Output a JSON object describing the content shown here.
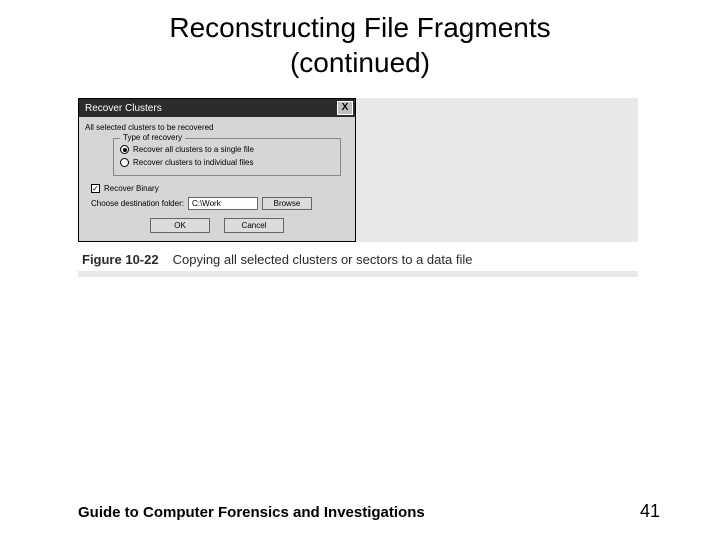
{
  "slide": {
    "title_line1": "Reconstructing File Fragments",
    "title_line2": "(continued)"
  },
  "dialog": {
    "title": "Recover Clusters",
    "close_glyph": "X",
    "note": "All selected clusters to be recovered",
    "group_title": "Type of recovery",
    "option1": "Recover all clusters to a single file",
    "option2": "Recover clusters to individual files",
    "recover_binary_label": "Recover Binary",
    "recover_binary_check": "✓",
    "dest_label": "Choose destination folder:",
    "dest_value": "C:\\Work",
    "browse_label": "Browse",
    "ok_label": "OK",
    "cancel_label": "Cancel"
  },
  "caption": {
    "number": "Figure 10-22",
    "text": "Copying all selected clusters or sectors to a data file"
  },
  "footer": {
    "book": "Guide to Computer Forensics and Investigations",
    "page": "41"
  }
}
